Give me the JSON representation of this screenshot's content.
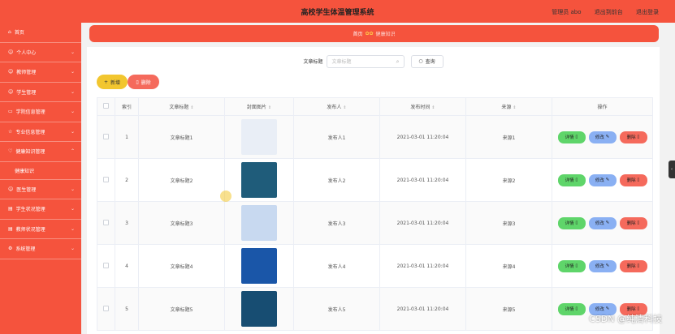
{
  "header": {
    "title": "高校学生体温管理系统",
    "user": "管理员 abo",
    "exit_frontend": "退出到前台",
    "logout": "退出登录"
  },
  "sidebar": {
    "items": [
      {
        "label": "首页",
        "icon": "home-icon"
      },
      {
        "label": "个人中心",
        "icon": "user-icon"
      },
      {
        "label": "教师管理",
        "icon": "teacher-icon"
      },
      {
        "label": "学生管理",
        "icon": "student-icon"
      },
      {
        "label": "学院信息管理",
        "icon": "college-icon"
      },
      {
        "label": "专业信息管理",
        "icon": "major-icon"
      },
      {
        "label": "健康知识管理",
        "icon": "health-icon"
      },
      {
        "label": "健康知识",
        "icon": "",
        "sub": true
      },
      {
        "label": "医生管理",
        "icon": "doctor-icon"
      },
      {
        "label": "学生状况管理",
        "icon": "student-status-icon"
      },
      {
        "label": "教师状况管理",
        "icon": "teacher-status-icon"
      },
      {
        "label": "系统管理",
        "icon": "system-icon"
      }
    ]
  },
  "breadcrumb": {
    "home": "首页",
    "current": "健康知识"
  },
  "search": {
    "label": "文章标题",
    "placeholder": "文章标题",
    "query_button": "查询"
  },
  "actions": {
    "add": "新增",
    "delete": "删除"
  },
  "table": {
    "headers": [
      "索引",
      "文章标题",
      "封面图片",
      "发布人",
      "发布时间",
      "来源",
      "操作"
    ],
    "op_labels": {
      "detail": "详情",
      "edit": "修改",
      "delete": "删除"
    },
    "rows": [
      {
        "index": "1",
        "title": "文章标题1",
        "publisher": "发布人1",
        "time": "2021-03-01 11:20:04",
        "source": "来源1",
        "cover_color": "#e9eef6"
      },
      {
        "index": "2",
        "title": "文章标题2",
        "publisher": "发布人2",
        "time": "2021-03-01 11:20:04",
        "source": "来源2",
        "cover_color": "#1f5c7a"
      },
      {
        "index": "3",
        "title": "文章标题3",
        "publisher": "发布人3",
        "time": "2021-03-01 11:20:04",
        "source": "来源3",
        "cover_color": "#c8d9f0"
      },
      {
        "index": "4",
        "title": "文章标题4",
        "publisher": "发布人4",
        "time": "2021-03-01 11:20:04",
        "source": "来源4",
        "cover_color": "#1a56a8"
      },
      {
        "index": "5",
        "title": "文章标题5",
        "publisher": "发布人5",
        "time": "2021-03-01 11:20:04",
        "source": "来源5",
        "cover_color": "#174d72"
      }
    ]
  },
  "watermark": "CSDN @纯清科技",
  "colors": {
    "primary": "#f5533d",
    "add": "#f2c62f",
    "detail": "#5fd56a",
    "edit": "#8ab0f3",
    "danger": "#f56a5c"
  }
}
